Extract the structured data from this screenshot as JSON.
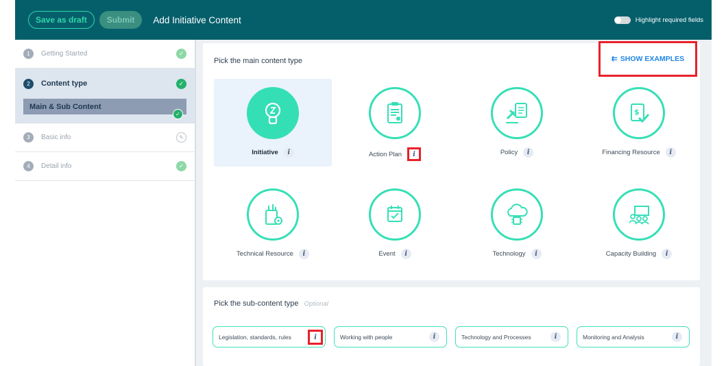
{
  "header": {
    "save_draft_label": "Save as draft",
    "submit_label": "Submit",
    "title": "Add Initiative Content",
    "highlight_label": "Highlight required fields",
    "highlight_on": false
  },
  "sidebar": {
    "steps": [
      {
        "num": "1",
        "label": "Getting Started",
        "status": "complete"
      },
      {
        "num": "2",
        "label": "Content type",
        "status": "complete",
        "active": true
      },
      {
        "num": "3",
        "label": "Basic info",
        "status": "editing"
      },
      {
        "num": "4",
        "label": "Detail info",
        "status": "complete"
      }
    ],
    "substep": {
      "label": "Main & Sub Content",
      "status": "complete"
    }
  },
  "main": {
    "title": "Pick the main content type",
    "show_examples_label": "SHOW EXAMPLES",
    "types": [
      {
        "label": "Initiative",
        "icon": "lightbulb-icon",
        "selected": true
      },
      {
        "label": "Action Plan",
        "icon": "clipboard-icon",
        "highlighted_info": true
      },
      {
        "label": "Policy",
        "icon": "gavel-document-icon"
      },
      {
        "label": "Financing Resource",
        "icon": "money-document-icon"
      },
      {
        "label": "Technical Resource",
        "icon": "toolbox-gear-icon"
      },
      {
        "label": "Event",
        "icon": "calendar-check-icon"
      },
      {
        "label": "Technology",
        "icon": "cloud-chip-icon"
      },
      {
        "label": "Capacity Building",
        "icon": "presentation-group-icon"
      }
    ]
  },
  "sub": {
    "title": "Pick the sub-content type",
    "optional_label": "Optional",
    "items": [
      {
        "label": "Legislation, standards, rules",
        "highlighted_info": true
      },
      {
        "label": "Working with people"
      },
      {
        "label": "Technology and Processes"
      },
      {
        "label": "Monitoring and Analysis"
      }
    ]
  },
  "colors": {
    "header_bg": "#055f6b",
    "accent": "#35dfb6",
    "highlight_box": "#e8202a",
    "link": "#1e86e6"
  }
}
